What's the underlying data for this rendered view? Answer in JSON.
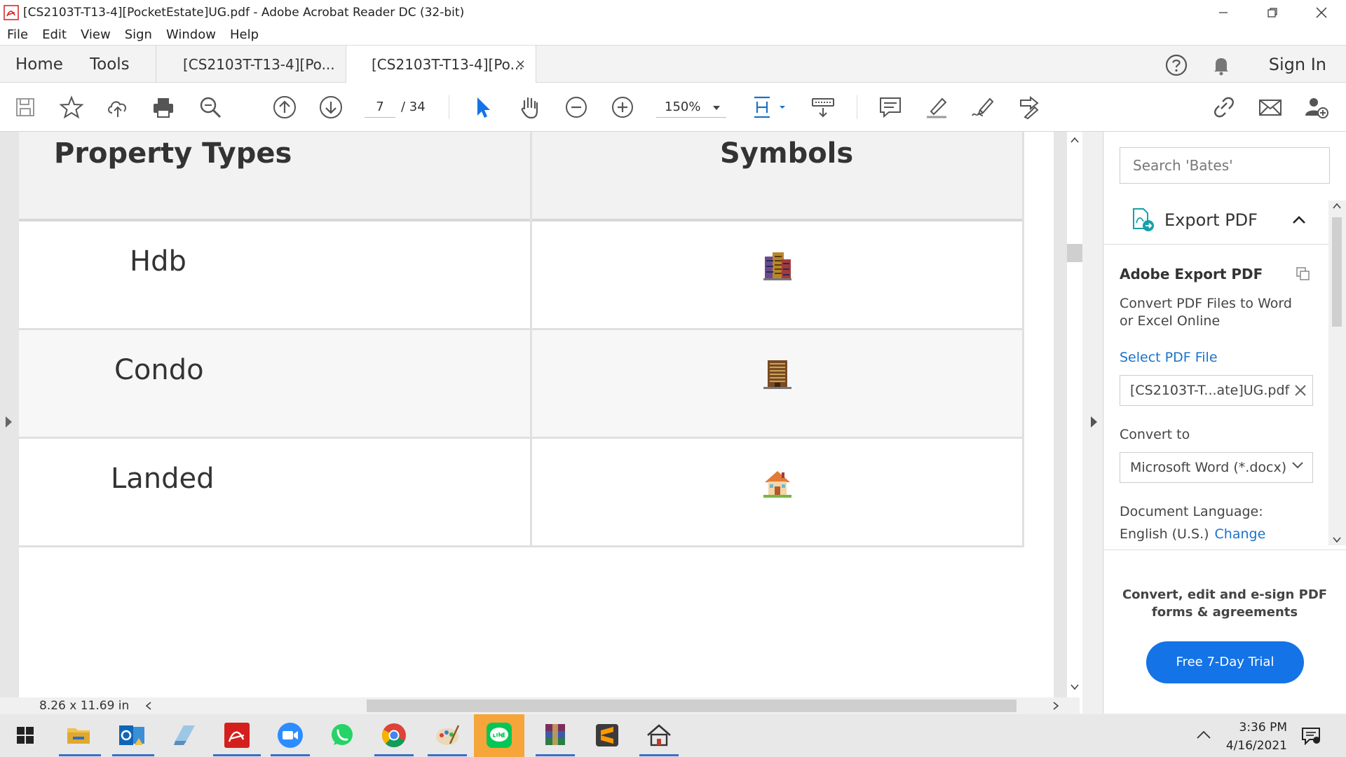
{
  "window": {
    "title": "[CS2103T-T13-4][PocketEstate]UG.pdf - Adobe Acrobat Reader DC (32-bit)"
  },
  "menu": [
    "File",
    "Edit",
    "View",
    "Sign",
    "Window",
    "Help"
  ],
  "tabs": {
    "home": "Home",
    "tools": "Tools",
    "doc_tab_1": "[CS2103T-T13-4][Po...",
    "doc_tab_2": "[CS2103T-T13-4][Po...",
    "close": "×",
    "sign_in": "Sign In"
  },
  "toolbar": {
    "page_current": "7",
    "page_total": "/ 34",
    "zoom": "150%"
  },
  "document": {
    "headers": [
      "Property Types",
      "Symbols"
    ],
    "rows": [
      {
        "type": "Hdb",
        "symbol_icon": "hdb-building-icon"
      },
      {
        "type": "Condo",
        "symbol_icon": "condo-building-icon"
      },
      {
        "type": "Landed",
        "symbol_icon": "house-icon"
      }
    ],
    "page_size": "8.26 x 11.69 in"
  },
  "right_panel": {
    "search_placeholder": "Search 'Bates'",
    "export_header": "Export PDF",
    "export_title": "Adobe Export PDF",
    "export_desc": "Convert PDF Files to Word or Excel Online",
    "select_file": "Select PDF File",
    "file_name": "[CS2103T-T...ate]UG.pdf",
    "convert_to": "Convert to",
    "format": "Microsoft Word (*.docx)",
    "doc_lang_label": "Document Language:",
    "doc_lang_value": "English (U.S.)",
    "change": "Change",
    "promo": "Convert, edit and e-sign PDF forms & agreements",
    "trial_button": "Free 7-Day Trial"
  },
  "taskbar": {
    "time": "3:36 PM",
    "date": "4/16/2021"
  },
  "colors": {
    "accent_blue": "#1473e6",
    "link_blue": "#1a73c8",
    "acrobat_red": "#d4201c"
  }
}
